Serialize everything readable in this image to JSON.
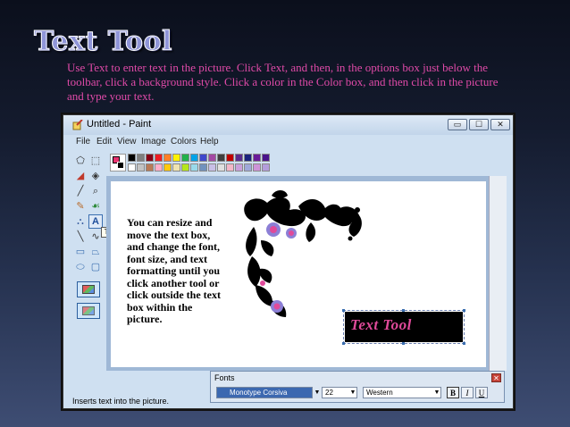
{
  "slide": {
    "title": "Text Tool",
    "body": "Use Text to enter text in the picture. Click Text, and then, in the options box just below the toolbar, click a background style. Click a color in the Color box, and then click in the picture and type your text."
  },
  "window": {
    "title": "Untitled - Paint",
    "minimize": "▭",
    "maximize": "☐",
    "close": "✕"
  },
  "menu": [
    "File",
    "Edit",
    "View",
    "Image",
    "Colors",
    "Help"
  ],
  "toolbox": {
    "tooltip": "Text",
    "tools": [
      {
        "name": "free-select-icon",
        "glyph": "⬠"
      },
      {
        "name": "rect-select-icon",
        "glyph": "⬚"
      },
      {
        "name": "eraser-icon",
        "glyph": "◢"
      },
      {
        "name": "fill-icon",
        "glyph": "◈"
      },
      {
        "name": "picker-icon",
        "glyph": "╱"
      },
      {
        "name": "magnifier-icon",
        "glyph": "⌕"
      },
      {
        "name": "pencil-icon",
        "glyph": "✎"
      },
      {
        "name": "brush-icon",
        "glyph": "☙"
      },
      {
        "name": "airbrush-icon",
        "glyph": "⛬"
      },
      {
        "name": "text-icon",
        "glyph": "A"
      },
      {
        "name": "line-icon",
        "glyph": "╲"
      },
      {
        "name": "curve-icon",
        "glyph": "∿"
      },
      {
        "name": "rectangle-icon",
        "glyph": "▭"
      },
      {
        "name": "polygon-icon",
        "glyph": "⏢"
      },
      {
        "name": "ellipse-icon",
        "glyph": "⬭"
      },
      {
        "name": "rounded-rect-icon",
        "glyph": "▢"
      }
    ]
  },
  "colors": {
    "foreground": "#e8336f",
    "background": "#000000",
    "palette_row1": [
      "#000000",
      "#7f7f7f",
      "#880015",
      "#ed1c24",
      "#ff7f27",
      "#fff200",
      "#22b14c",
      "#00a2e8",
      "#3f48cc",
      "#a349a4",
      "#404040",
      "#c00000",
      "#5b2c8f",
      "#1a237e",
      "#6a1b9a",
      "#4a148c"
    ],
    "palette_row2": [
      "#ffffff",
      "#c3c3c3",
      "#b97a57",
      "#ffaec9",
      "#ffc90e",
      "#efe4b0",
      "#b5e61d",
      "#99d9ea",
      "#7092be",
      "#c8bfe7",
      "#e0e0e0",
      "#f3b7c9",
      "#c9a0dc",
      "#9fa8da",
      "#ce93d8",
      "#b39ddb"
    ]
  },
  "canvas": {
    "text_block": "You can resize and move the text box, and change the font, font size, and text formatting until you click another tool or click outside the text box within the picture.",
    "text_tool_label": "Text  Tool"
  },
  "fonts_toolbar": {
    "title": "Fonts",
    "font_name": "Monotype Corsiva",
    "font_size": "22",
    "script": "Western",
    "bold": "B",
    "italic": "I",
    "underline": "U"
  },
  "status": "Inserts text into the picture."
}
